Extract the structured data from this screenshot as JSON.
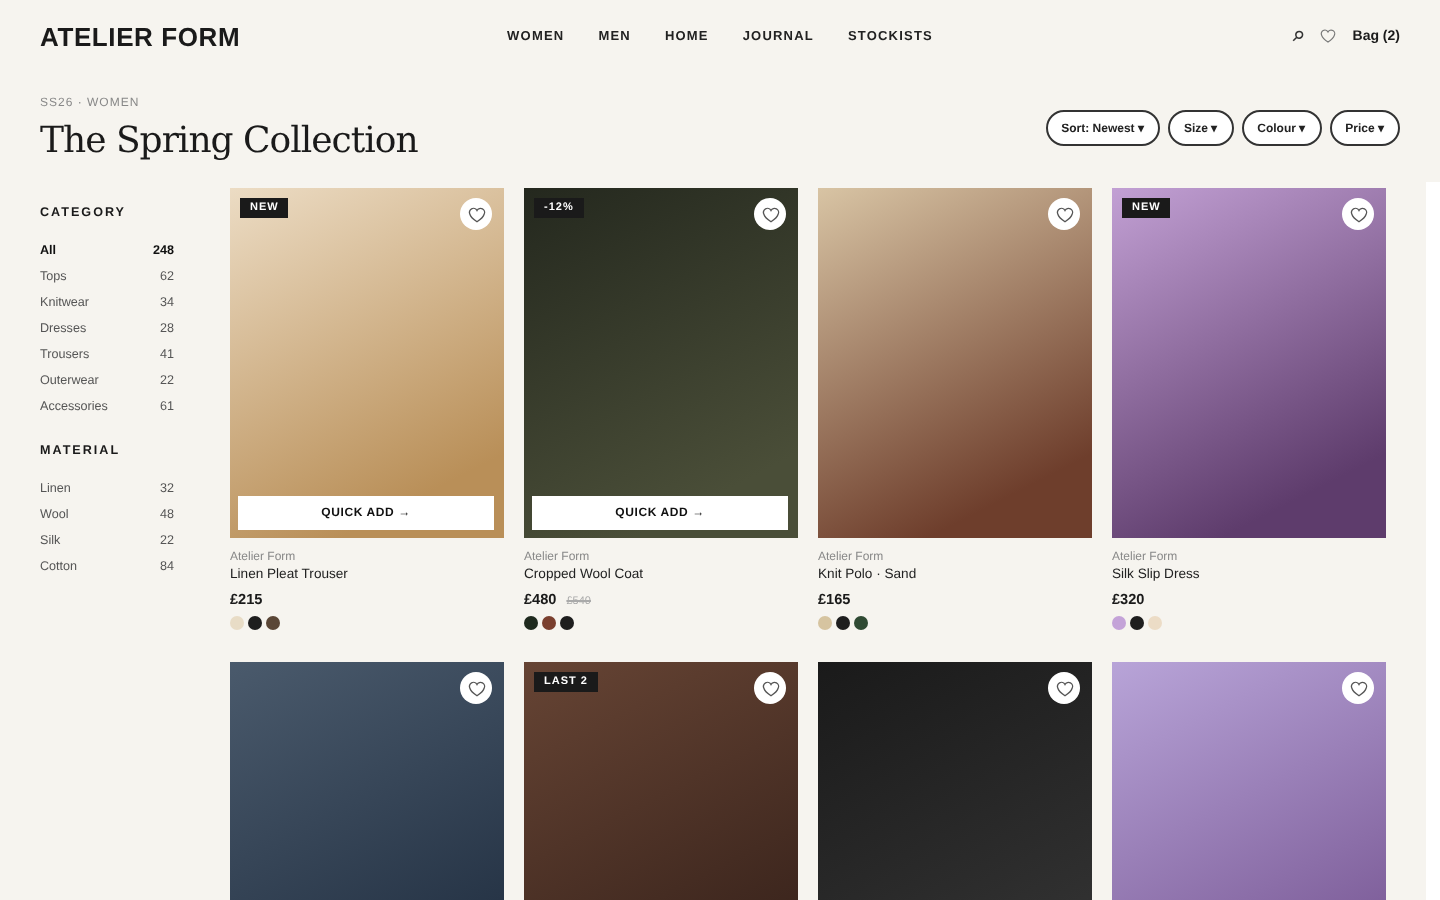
{
  "brand": "ATELIER FORM",
  "nav": [
    {
      "label": "WOMEN"
    },
    {
      "label": "MEN"
    },
    {
      "label": "HOME"
    },
    {
      "label": "JOURNAL"
    },
    {
      "label": "STOCKISTS"
    }
  ],
  "bag": "Bag (2)",
  "breadcrumb": "SS26 · WOMEN",
  "title": "The Spring Collection",
  "filters": [
    "Sort: Newest ▾",
    "Size ▾",
    "Colour ▾",
    "Price ▾"
  ],
  "sidebar": [
    {
      "heading": "CATEGORY",
      "items": [
        {
          "label": "All",
          "count": "248",
          "selected": true
        },
        {
          "label": "Tops",
          "count": "62",
          "selected": false
        },
        {
          "label": "Knitwear",
          "count": "34",
          "selected": false
        },
        {
          "label": "Dresses",
          "count": "28",
          "selected": false
        },
        {
          "label": "Trousers",
          "count": "41",
          "selected": false
        },
        {
          "label": "Outerwear",
          "count": "22",
          "selected": false
        },
        {
          "label": "Accessories",
          "count": "61",
          "selected": false
        }
      ]
    },
    {
      "heading": "MATERIAL",
      "items": [
        {
          "label": "Linen",
          "count": "32",
          "selected": false
        },
        {
          "label": "Wool",
          "count": "48",
          "selected": false
        },
        {
          "label": "Silk",
          "count": "22",
          "selected": false
        },
        {
          "label": "Cotton",
          "count": "84",
          "selected": false
        }
      ]
    }
  ],
  "products": [
    {
      "kind": "picture",
      "badge": "NEW",
      "quick_add": "QUICK ADD →",
      "maker": "Atelier Form",
      "name": "Linen Pleat Trouser",
      "price": "£215",
      "swatches": [
        {
          "color": "#e8dcc6"
        },
        {
          "color": "#1e1e1e"
        },
        {
          "color": "#5a4636"
        }
      ]
    },
    {
      "kind": "picture",
      "badge": "-12%",
      "quick_add": "QUICK ADD →",
      "maker": "Atelier Form",
      "name": "Cropped Wool Coat",
      "price": "£480",
      "old_price": "£540",
      "swatches": [
        {
          "color": "#1f2a1e"
        },
        {
          "color": "#7a3f2e"
        },
        {
          "color": "#1e1e1e"
        }
      ]
    },
    {
      "kind": "picture",
      "maker": "Atelier Form",
      "name": "Knit Polo · Sand",
      "price": "£165",
      "swatches": [
        {
          "color": "#d6c4a0"
        },
        {
          "color": "#1e1e1e"
        },
        {
          "color": "#2f4a33"
        }
      ]
    },
    {
      "kind": "picture",
      "badge": "NEW",
      "maker": "Atelier Form",
      "name": "Silk Slip Dress",
      "price": "£320",
      "swatches": [
        {
          "color": "#c4a3d8"
        },
        {
          "color": "#1e1e1e"
        },
        {
          "color": "#ecdcc6"
        }
      ]
    },
    {
      "kind": "picture"
    },
    {
      "kind": "picture",
      "badge": "LAST 2"
    },
    {
      "kind": "picture"
    },
    {
      "kind": "picture"
    }
  ]
}
